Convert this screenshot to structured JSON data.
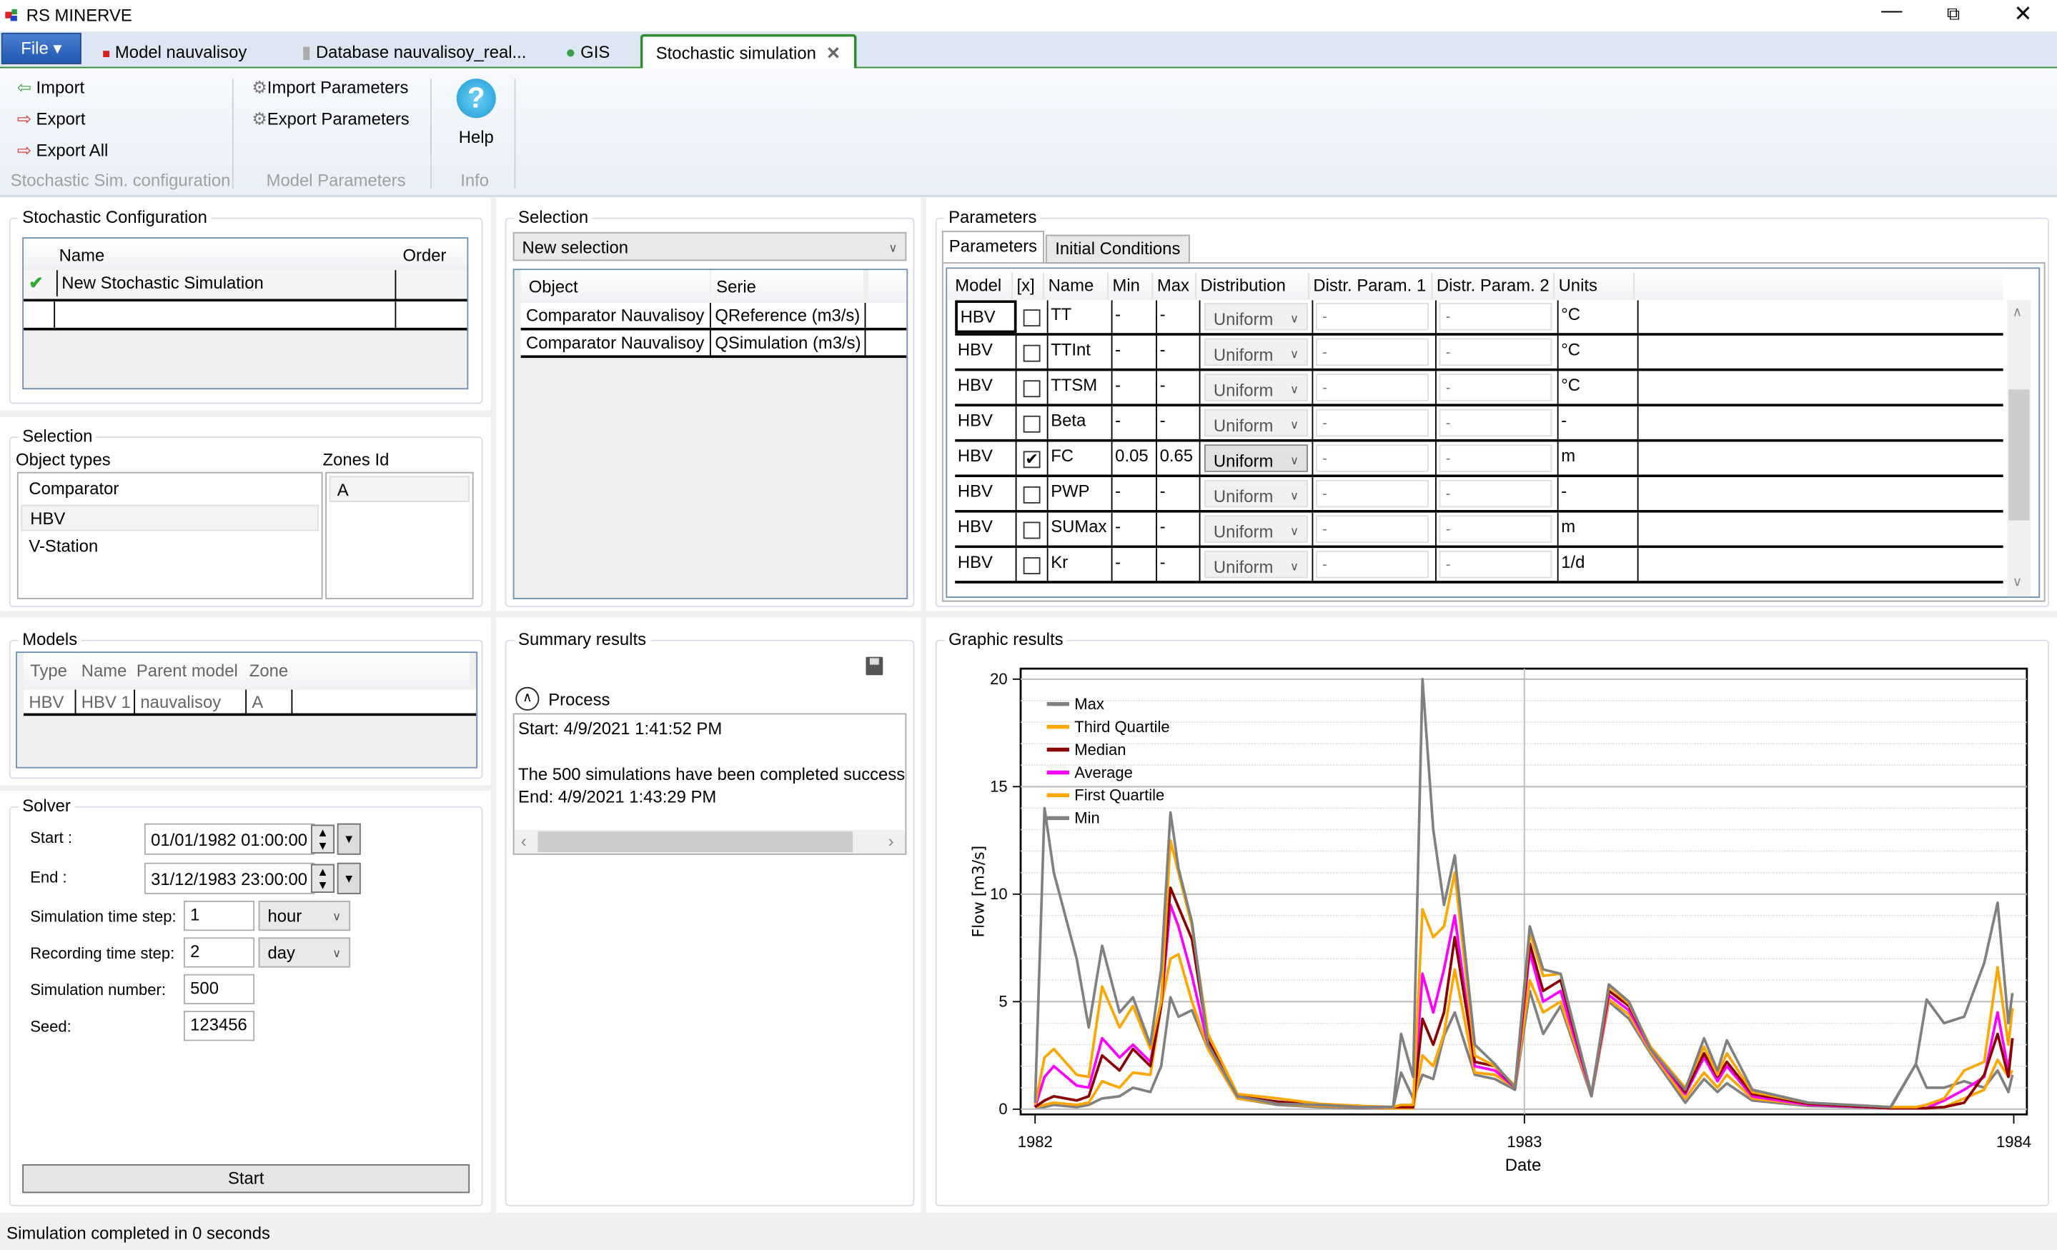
{
  "app": {
    "title": "RS MINERVE",
    "window_controls": [
      "minimize",
      "restore",
      "close"
    ]
  },
  "tabs": {
    "file": "File ▾",
    "items": [
      {
        "label": "Model nauvalisoy",
        "icon": "model-icon"
      },
      {
        "label": "Database nauvalisoy_real...",
        "icon": "database-icon"
      },
      {
        "label": "GIS",
        "icon": "globe-icon"
      },
      {
        "label": "Stochastic simulation",
        "icon": "close-icon",
        "active": true
      }
    ]
  },
  "ribbon": {
    "config": {
      "import": "Import",
      "export": "Export",
      "export_all": "Export All",
      "group": "Stochastic Sim. configuration"
    },
    "params": {
      "import": "Import Parameters",
      "export": "Export Parameters",
      "group": "Model Parameters"
    },
    "info": {
      "help": "Help",
      "group": "Info"
    }
  },
  "stochastic_config": {
    "title": "Stochastic Configuration",
    "columns": [
      "Name",
      "Order"
    ],
    "rows": [
      {
        "name": "New Stochastic Simulation",
        "order": "",
        "checked": true
      },
      {
        "name": "",
        "order": ""
      }
    ]
  },
  "selection_left": {
    "title": "Selection",
    "object_types_label": "Object types",
    "zones_label": "Zones Id",
    "object_types": [
      "Comparator",
      "HBV",
      "V-Station"
    ],
    "selected_type": "HBV",
    "zones": [
      "A"
    ]
  },
  "models": {
    "title": "Models",
    "columns": [
      "Type",
      "Name",
      "Parent model",
      "Zone"
    ],
    "rows": [
      [
        "HBV",
        "HBV 1",
        "nauvalisoy",
        "A"
      ]
    ]
  },
  "solver": {
    "title": "Solver",
    "start_label": "Start :",
    "start": "01/01/1982 01:00:00",
    "end_label": "End :",
    "end": "31/12/1983 23:00:00",
    "sim_step_label": "Simulation time step:",
    "sim_step": "1",
    "sim_step_unit": "hour",
    "rec_step_label": "Recording time step:",
    "rec_step": "2",
    "rec_step_unit": "day",
    "sim_number_label": "Simulation number:",
    "sim_number": "500",
    "seed_label": "Seed:",
    "seed": "123456",
    "start_button": "Start"
  },
  "selection_mid": {
    "title": "Selection",
    "dropdown": "New selection",
    "columns": [
      "Object",
      "Serie"
    ],
    "rows": [
      [
        "Comparator Nauvalisoy",
        "QReference (m3/s)"
      ],
      [
        "Comparator Nauvalisoy",
        "QSimulation (m3/s)"
      ]
    ]
  },
  "summary": {
    "title": "Summary results",
    "process_label": "Process",
    "lines": [
      "Start: 4/9/2021 1:41:52 PM",
      "",
      "The 500 simulations have been completed successf",
      "End: 4/9/2021 1:43:29 PM"
    ]
  },
  "parameters": {
    "title": "Parameters",
    "tabs": [
      "Parameters",
      "Initial Conditions"
    ],
    "active_tab": "Parameters",
    "columns": [
      "Model",
      "[x]",
      "Name",
      "Min",
      "Max",
      "Distribution",
      "Distr. Param. 1",
      "Distr. Param. 2",
      "Units"
    ],
    "rows": [
      {
        "model": "HBV",
        "checked": false,
        "name": "TT",
        "min": "-",
        "max": "-",
        "dist": "Uniform",
        "p1": "-",
        "p2": "-",
        "units": "°C"
      },
      {
        "model": "HBV",
        "checked": false,
        "name": "TTInt",
        "min": "-",
        "max": "-",
        "dist": "Uniform",
        "p1": "-",
        "p2": "-",
        "units": "°C"
      },
      {
        "model": "HBV",
        "checked": false,
        "name": "TTSM",
        "min": "-",
        "max": "-",
        "dist": "Uniform",
        "p1": "-",
        "p2": "-",
        "units": "°C"
      },
      {
        "model": "HBV",
        "checked": false,
        "name": "Beta",
        "min": "-",
        "max": "-",
        "dist": "Uniform",
        "p1": "-",
        "p2": "-",
        "units": "-"
      },
      {
        "model": "HBV",
        "checked": true,
        "name": "FC",
        "min": "0.05",
        "max": "0.65",
        "dist": "Uniform",
        "p1": "-",
        "p2": "-",
        "units": "m"
      },
      {
        "model": "HBV",
        "checked": false,
        "name": "PWP",
        "min": "-",
        "max": "-",
        "dist": "Uniform",
        "p1": "-",
        "p2": "-",
        "units": "-"
      },
      {
        "model": "HBV",
        "checked": false,
        "name": "SUMax",
        "min": "-",
        "max": "-",
        "dist": "Uniform",
        "p1": "-",
        "p2": "-",
        "units": "m"
      },
      {
        "model": "HBV",
        "checked": false,
        "name": "Kr",
        "min": "-",
        "max": "-",
        "dist": "Uniform",
        "p1": "-",
        "p2": "-",
        "units": "1/d"
      }
    ]
  },
  "graphic": {
    "title": "Graphic results"
  },
  "chart_data": {
    "type": "line",
    "xlabel": "Date",
    "ylabel": "Flow [m3/s]",
    "xlim": [
      "1982-01-01",
      "1984-01-01"
    ],
    "xticks": [
      "1982",
      "1983",
      "1984"
    ],
    "ylim": [
      0,
      20
    ],
    "yticks": [
      0,
      5,
      10,
      15,
      20
    ],
    "grid": true,
    "legend": "top-left",
    "x": [
      "1982-01-01",
      "1982-01-08",
      "1982-01-15",
      "1982-02-01",
      "1982-02-10",
      "1982-02-20",
      "1982-03-05",
      "1982-03-15",
      "1982-03-28",
      "1982-04-05",
      "1982-04-12",
      "1982-04-18",
      "1982-04-28",
      "1982-05-10",
      "1982-06-01",
      "1982-07-01",
      "1982-08-01",
      "1982-09-01",
      "1982-09-25",
      "1982-10-01",
      "1982-10-10",
      "1982-10-17",
      "1982-10-25",
      "1982-11-02",
      "1982-11-10",
      "1982-11-25",
      "1982-12-10",
      "1982-12-25",
      "1983-01-05",
      "1983-01-15",
      "1983-01-28",
      "1983-02-20",
      "1983-03-05",
      "1983-03-20",
      "1983-04-05",
      "1983-05-01",
      "1983-05-15",
      "1983-05-25",
      "1983-06-01",
      "1983-06-20",
      "1983-08-01",
      "1983-10-01",
      "1983-10-20",
      "1983-10-28",
      "1983-11-10",
      "1983-11-25",
      "1983-12-10",
      "1983-12-20",
      "1983-12-28",
      "1983-12-31"
    ],
    "series": [
      {
        "name": "Max",
        "color": "#808080",
        "values": [
          0.3,
          14.0,
          11.0,
          7.0,
          3.8,
          7.6,
          4.5,
          5.2,
          3.0,
          6.5,
          13.8,
          11.2,
          8.7,
          3.0,
          0.6,
          0.25,
          0.2,
          0.1,
          0.1,
          3.5,
          1.5,
          20.0,
          13.0,
          9.5,
          11.8,
          3.0,
          2.1,
          1.0,
          8.5,
          6.5,
          6.3,
          0.7,
          5.8,
          5.0,
          2.8,
          0.9,
          3.3,
          1.8,
          3.2,
          0.9,
          0.3,
          0.1,
          2.1,
          5.1,
          4.0,
          4.3,
          6.8,
          9.6,
          4.0,
          5.4
        ]
      },
      {
        "name": "Third Quartile",
        "color": "#ffa500",
        "values": [
          0.2,
          2.4,
          2.8,
          1.6,
          1.5,
          5.7,
          3.8,
          4.8,
          2.8,
          5.0,
          12.5,
          11.0,
          8.5,
          3.5,
          0.7,
          0.5,
          0.25,
          0.15,
          0.1,
          0.2,
          0.2,
          9.3,
          8.0,
          8.5,
          11.0,
          2.5,
          2.0,
          1.1,
          8.2,
          6.2,
          6.3,
          0.7,
          5.7,
          4.9,
          2.9,
          1.0,
          2.9,
          1.6,
          2.6,
          0.8,
          0.3,
          0.1,
          0.1,
          0.2,
          0.5,
          1.8,
          2.2,
          6.6,
          3.0,
          4.7
        ]
      },
      {
        "name": "Median",
        "color": "#8b0000",
        "values": [
          0.1,
          0.4,
          0.6,
          0.4,
          0.6,
          2.5,
          1.8,
          2.8,
          2.0,
          4.8,
          10.3,
          9.4,
          7.9,
          3.2,
          0.6,
          0.35,
          0.2,
          0.12,
          0.1,
          0.1,
          0.1,
          4.2,
          3.0,
          4.5,
          8.0,
          2.2,
          2.0,
          1.0,
          7.7,
          5.5,
          6.0,
          0.7,
          5.5,
          4.8,
          2.9,
          0.8,
          2.6,
          1.5,
          2.2,
          0.7,
          0.25,
          0.05,
          0.05,
          0.05,
          0.1,
          0.3,
          1.6,
          3.5,
          1.5,
          3.3
        ]
      },
      {
        "name": "Average",
        "color": "#ff00ff",
        "values": [
          0.1,
          1.5,
          2.0,
          1.1,
          1.0,
          3.3,
          2.4,
          3.0,
          2.2,
          4.8,
          9.5,
          8.5,
          6.2,
          3.0,
          0.6,
          0.3,
          0.2,
          0.1,
          0.1,
          0.1,
          0.1,
          6.3,
          4.5,
          6.5,
          9.0,
          2.0,
          1.8,
          1.0,
          7.3,
          5.0,
          5.5,
          0.7,
          5.3,
          4.6,
          2.8,
          0.7,
          2.4,
          1.3,
          2.0,
          0.6,
          0.2,
          0.05,
          0.05,
          0.05,
          0.4,
          0.9,
          1.5,
          4.5,
          1.8,
          3.3
        ]
      },
      {
        "name": "First Quartile",
        "color": "#ffa500",
        "values": [
          0.1,
          0.2,
          0.3,
          0.2,
          0.3,
          1.3,
          1.0,
          1.7,
          1.6,
          4.8,
          7.0,
          7.2,
          5.0,
          2.8,
          0.5,
          0.25,
          0.15,
          0.1,
          0.05,
          0.05,
          0.05,
          2.5,
          2.0,
          3.5,
          6.5,
          1.7,
          1.6,
          1.0,
          6.0,
          4.5,
          5.0,
          0.7,
          5.1,
          4.4,
          2.7,
          0.5,
          1.7,
          1.0,
          1.6,
          0.5,
          0.2,
          0.05,
          0.05,
          0.05,
          0.1,
          0.5,
          0.9,
          2.3,
          1.5,
          1.8
        ]
      },
      {
        "name": "Min",
        "color": "#808080",
        "values": [
          0.1,
          0.1,
          0.2,
          0.1,
          0.2,
          0.5,
          0.6,
          1.0,
          0.8,
          2.0,
          5.2,
          4.3,
          4.6,
          2.8,
          0.5,
          0.2,
          0.1,
          0.05,
          0.05,
          1.7,
          0.5,
          1.6,
          1.4,
          3.4,
          4.5,
          1.6,
          1.4,
          0.9,
          5.5,
          3.5,
          4.8,
          0.6,
          5.0,
          4.2,
          2.6,
          0.3,
          1.4,
          0.8,
          1.2,
          0.4,
          0.15,
          0.05,
          2.1,
          1.0,
          1.0,
          1.3,
          1.0,
          1.8,
          0.8,
          1.6
        ]
      }
    ]
  },
  "status": {
    "text": "Simulation completed in 0 seconds"
  }
}
